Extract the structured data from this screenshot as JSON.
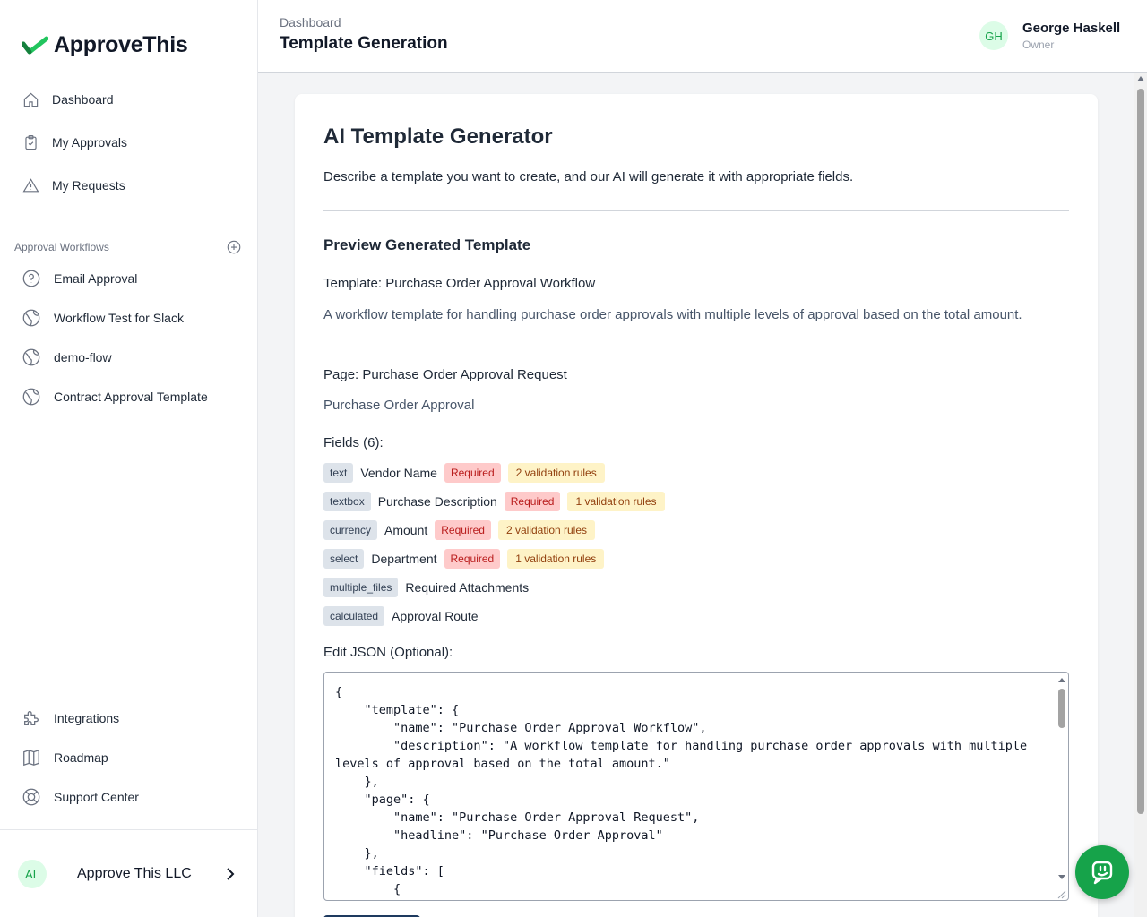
{
  "brand": {
    "name": "ApproveThis",
    "accent": "#16a34a"
  },
  "nav": {
    "dashboard": "Dashboard",
    "my_approvals": "My Approvals",
    "my_requests": "My Requests"
  },
  "workflows": {
    "section_label": "Approval Workflows",
    "items": [
      "Email Approval",
      "Workflow Test for Slack",
      "demo-flow",
      "Contract Approval Template"
    ]
  },
  "bottom_nav": {
    "integrations": "Integrations",
    "roadmap": "Roadmap",
    "support": "Support Center"
  },
  "org": {
    "initials": "AL",
    "name": "Approve This LLC"
  },
  "header": {
    "breadcrumb": "Dashboard",
    "title": "Template Generation",
    "user": {
      "initials": "GH",
      "name": "George Haskell",
      "role": "Owner"
    }
  },
  "generator": {
    "title": "AI Template Generator",
    "description": "Describe a template you want to create, and our AI will generate it with appropriate fields.",
    "preview_title": "Preview Generated Template",
    "template_name": "Template: Purchase Order Approval Workflow",
    "template_description": "A workflow template for handling purchase order approvals with multiple levels of approval based on the total amount.",
    "page_name": "Page: Purchase Order Approval Request",
    "page_headline": "Purchase Order Approval",
    "fields_label": "Fields (6):",
    "fields": [
      {
        "type": "text",
        "name": "Vendor Name",
        "required": "Required",
        "rules": "2 validation rules"
      },
      {
        "type": "textbox",
        "name": "Purchase Description",
        "required": "Required",
        "rules": "1 validation rules"
      },
      {
        "type": "currency",
        "name": "Amount",
        "required": "Required",
        "rules": "2 validation rules"
      },
      {
        "type": "select",
        "name": "Department",
        "required": "Required",
        "rules": "1 validation rules"
      },
      {
        "type": "multiple_files",
        "name": "Required Attachments"
      },
      {
        "type": "calculated",
        "name": "Approval Route"
      }
    ],
    "json_label": "Edit JSON (Optional):",
    "json_text": "{\n    \"template\": {\n        \"name\": \"Purchase Order Approval Workflow\",\n        \"description\": \"A workflow template for handling purchase order approvals with multiple levels of approval based on the total amount.\"\n    },\n    \"page\": {\n        \"name\": \"Purchase Order Approval Request\",\n        \"headline\": \"Purchase Order Approval\"\n    },\n    \"fields\": [\n        {"
  }
}
